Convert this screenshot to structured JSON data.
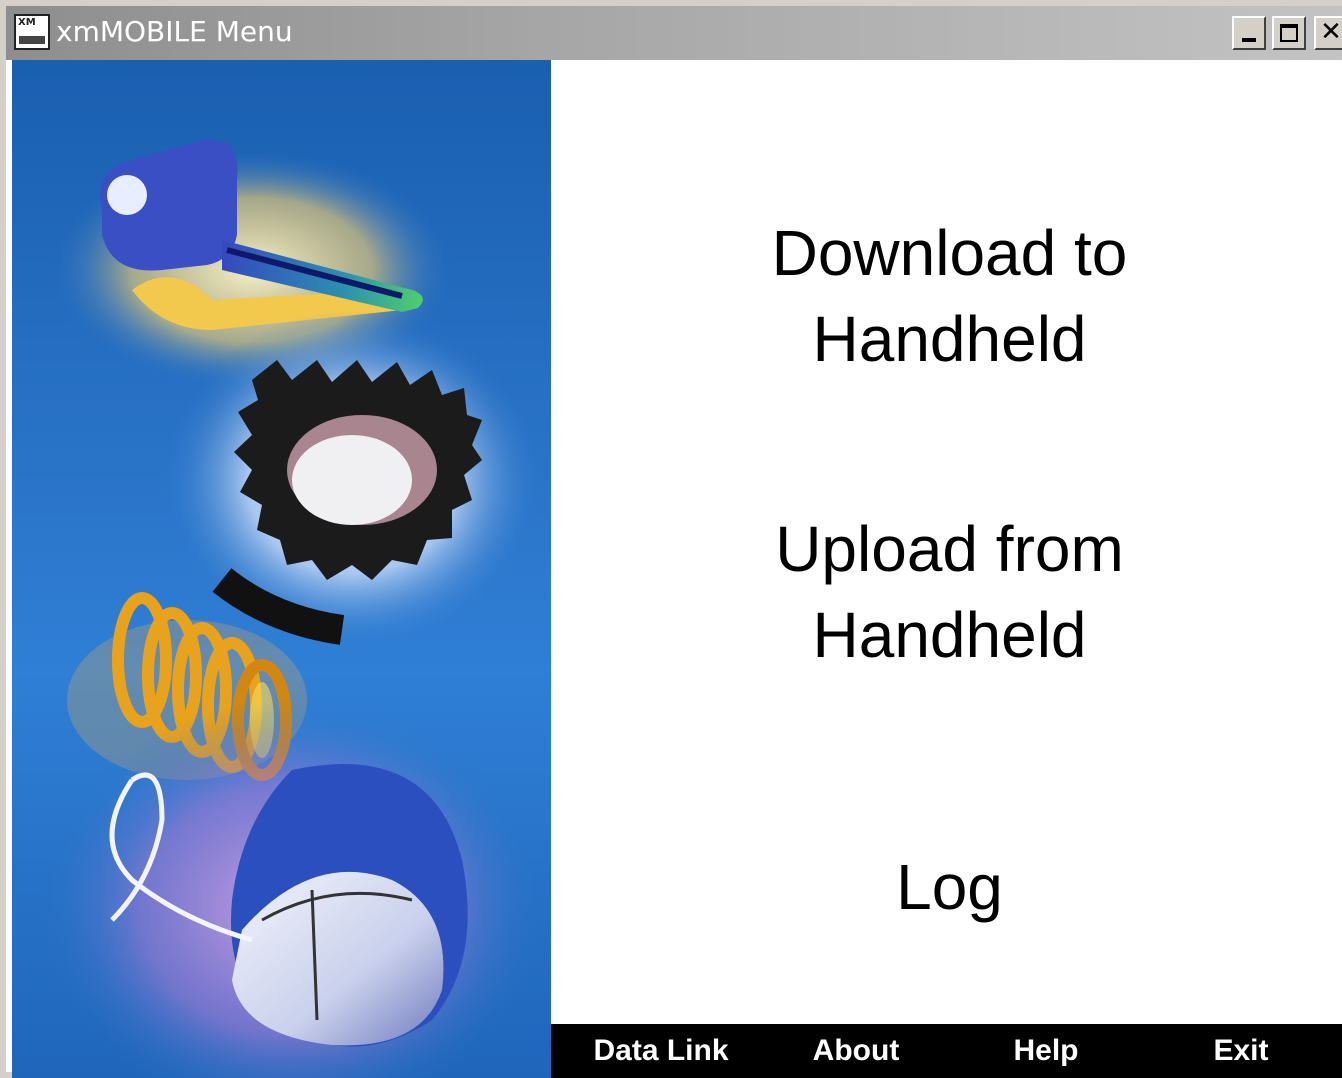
{
  "window": {
    "title": "xmMOBILE Menu",
    "icon_tag": "XM"
  },
  "controls": {
    "minimize": "minimize",
    "maximize": "maximize",
    "close": "✕"
  },
  "menu": {
    "download_line1": "Download to",
    "download_line2": "Handheld",
    "upload_line1": "Upload from",
    "upload_line2": "Handheld",
    "log": "Log"
  },
  "bottom_bar": {
    "datalink": "Data Link",
    "about": "About",
    "help": "Help",
    "exit": "Exit"
  },
  "artwork": {
    "icons": [
      "key-icon",
      "gear-icon",
      "coil-icon",
      "mouse-icon"
    ],
    "colors": {
      "background_blue": "#2a74c8",
      "key": "#3b4fc4",
      "gear": "#1a1a1a",
      "coil": "#e8a21c",
      "mouse": "#d9def0"
    }
  }
}
